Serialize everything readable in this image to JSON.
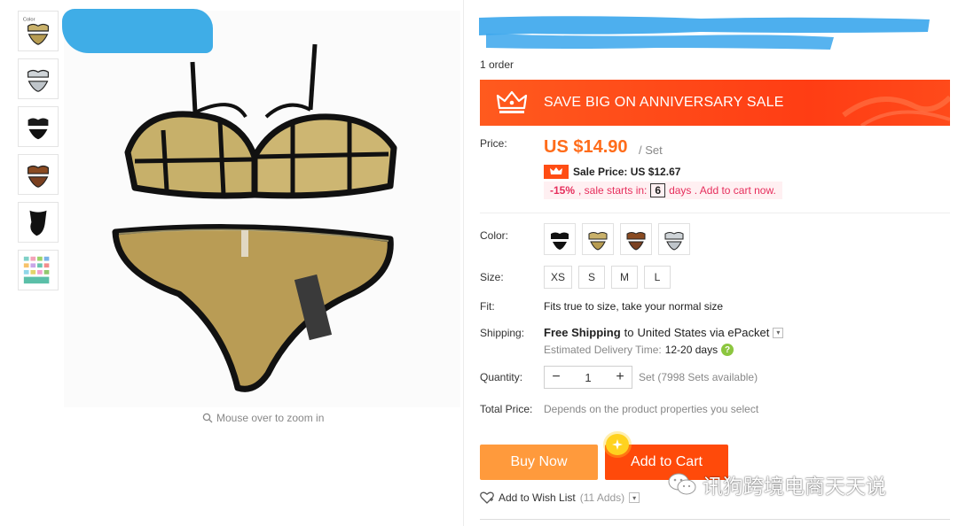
{
  "thumbnails": [
    {
      "icon": "gold-bikini-thumbnail",
      "label": "Color"
    },
    {
      "icon": "silver-bikini-thumbnail"
    },
    {
      "icon": "black-bikini-thumbnail"
    },
    {
      "icon": "bronze-bikini-thumbnail"
    },
    {
      "icon": "black-one-piece-thumbnail"
    },
    {
      "icon": "color-chart-thumbnail"
    }
  ],
  "gallery": {
    "zoom_hint": "Mouse over to zoom in"
  },
  "product": {
    "orders": "1 order"
  },
  "banner": {
    "text": "SAVE BIG ON ANNIVERSARY SALE"
  },
  "price": {
    "label": "Price:",
    "value": "US $14.90",
    "unit": "/ Set",
    "sale_label": "Sale Price: US $12.67",
    "discount": "-15%",
    "discount_text": ", sale starts in:",
    "days": "6",
    "days_text": "days . Add to cart now."
  },
  "color": {
    "label": "Color:",
    "options": [
      "black-swatch",
      "gold-swatch",
      "bronze-swatch",
      "silver-swatch"
    ]
  },
  "size": {
    "label": "Size:",
    "options": [
      "XS",
      "S",
      "M",
      "L"
    ]
  },
  "fit": {
    "label": "Fit:",
    "text": "Fits true to size, take your normal size"
  },
  "shipping": {
    "label": "Shipping:",
    "free": "Free Shipping",
    "to": "to",
    "destination": "United States via ePacket",
    "est_label": "Estimated Delivery Time:",
    "est_days": "12-20 days"
  },
  "quantity": {
    "label": "Quantity:",
    "value": "1",
    "note": "Set (7998 Sets available)"
  },
  "total": {
    "label": "Total Price:",
    "text": "Depends on the product properties you select"
  },
  "actions": {
    "buy_now": "Buy Now",
    "add_to_cart": "Add to Cart",
    "wishlist": "Add to Wish List",
    "wishlist_count": "(11 Adds)"
  },
  "watermark": {
    "text": "讯狗跨境电商天天说"
  },
  "colors": {
    "accent_orange": "#ff6c1a",
    "banner_red": "#ff3d14",
    "buy_now": "#ff9a3c",
    "add_to_cart": "#ff4a0a",
    "discount_pink": "#e62e5c"
  }
}
